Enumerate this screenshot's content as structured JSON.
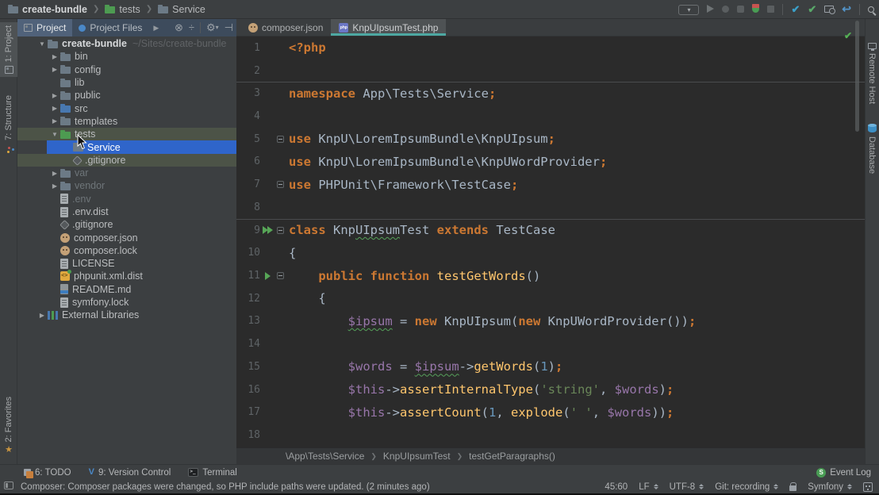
{
  "navbar": {
    "breadcrumbs": [
      {
        "label": "create-bundle",
        "icon": "folder"
      },
      {
        "label": "tests",
        "icon": "folder-green"
      },
      {
        "label": "Service",
        "icon": "folder"
      }
    ],
    "toolbar_icons": [
      "run-config-combo",
      "run",
      "debug",
      "kill",
      "run-with-coverage",
      "stop",
      "sep",
      "update-project",
      "commit",
      "local-history",
      "rollback",
      "sep",
      "search-everywhere"
    ]
  },
  "left_stripe": {
    "top": [
      {
        "label": "1: Project",
        "icon": "project"
      },
      {
        "label": "7: Structure",
        "icon": "structure"
      }
    ],
    "bottom": [
      {
        "label": "2: Favorites",
        "icon": "star"
      }
    ]
  },
  "right_stripe": {
    "items": [
      {
        "label": "Remote Host",
        "icon": "remote"
      },
      {
        "label": "Database",
        "icon": "db"
      }
    ]
  },
  "project_panel": {
    "tabs": [
      {
        "label": "Project",
        "selected": true
      },
      {
        "label": "Project Files",
        "selected": false
      }
    ],
    "header_icons": [
      "locate",
      "collapse-all",
      "sep",
      "settings",
      "hide"
    ],
    "tree": [
      {
        "depth": 0,
        "arrow": "down",
        "icon": "folder",
        "label": "create-bundle",
        "bold": true,
        "extra": "~/Sites/create-bundle"
      },
      {
        "depth": 1,
        "arrow": "right",
        "icon": "folder",
        "label": "bin"
      },
      {
        "depth": 1,
        "arrow": "right",
        "icon": "folder",
        "label": "config"
      },
      {
        "depth": 1,
        "arrow": "none",
        "icon": "folder",
        "label": "lib"
      },
      {
        "depth": 1,
        "arrow": "right",
        "icon": "folder",
        "label": "public"
      },
      {
        "depth": 1,
        "arrow": "right",
        "icon": "folder-src",
        "label": "src"
      },
      {
        "depth": 1,
        "arrow": "right",
        "icon": "folder",
        "label": "templates"
      },
      {
        "depth": 1,
        "arrow": "down",
        "icon": "folder-test",
        "label": "tests",
        "hl": "green"
      },
      {
        "depth": 2,
        "arrow": "none",
        "icon": "folder",
        "label": "Service",
        "hl": "selected"
      },
      {
        "depth": 2,
        "arrow": "none",
        "icon": "gitignore",
        "label": ".gitignore",
        "hl": "green"
      },
      {
        "depth": 1,
        "arrow": "right",
        "icon": "folder",
        "label": "var",
        "dim": true
      },
      {
        "depth": 1,
        "arrow": "right",
        "icon": "folder",
        "label": "vendor",
        "dim": true
      },
      {
        "depth": 1,
        "arrow": "none",
        "icon": "file",
        "label": ".env",
        "dim": true
      },
      {
        "depth": 1,
        "arrow": "none",
        "icon": "file",
        "label": ".env.dist"
      },
      {
        "depth": 1,
        "arrow": "none",
        "icon": "gitignore",
        "label": ".gitignore"
      },
      {
        "depth": 1,
        "arrow": "none",
        "icon": "composer",
        "label": "composer.json"
      },
      {
        "depth": 1,
        "arrow": "none",
        "icon": "composer",
        "label": "composer.lock"
      },
      {
        "depth": 1,
        "arrow": "none",
        "icon": "file",
        "label": "LICENSE"
      },
      {
        "depth": 1,
        "arrow": "none",
        "icon": "phpunit",
        "label": "phpunit.xml.dist"
      },
      {
        "depth": 1,
        "arrow": "none",
        "icon": "readme",
        "label": "README.md"
      },
      {
        "depth": 1,
        "arrow": "none",
        "icon": "file",
        "label": "symfony.lock"
      },
      {
        "depth": 0,
        "arrow": "right",
        "icon": "libs",
        "label": "External Libraries"
      }
    ]
  },
  "editor": {
    "tabs": [
      {
        "label": "composer.json",
        "icon": "composer",
        "active": false
      },
      {
        "label": "KnpUIpsumTest.php",
        "icon": "php-file",
        "active": true
      }
    ],
    "lines": [
      {
        "n": "1",
        "tokens": [
          [
            "tag",
            "<?php"
          ]
        ]
      },
      {
        "n": "2",
        "tokens": []
      },
      {
        "n": "3",
        "sep": true,
        "tokens": [
          [
            "kw",
            "namespace"
          ],
          [
            "d",
            " App\\Tests\\Service"
          ],
          [
            "kw",
            ";"
          ]
        ]
      },
      {
        "n": "4",
        "tokens": []
      },
      {
        "n": "5",
        "fold": true,
        "tokens": [
          [
            "kw",
            "use"
          ],
          [
            "d",
            " KnpU\\LoremIpsumBundle\\KnpUIpsum"
          ],
          [
            "kw",
            ";"
          ]
        ]
      },
      {
        "n": "6",
        "tokens": [
          [
            "kw",
            "use"
          ],
          [
            "d",
            " KnpU\\LoremIpsumBundle\\KnpUWordProvider"
          ],
          [
            "kw",
            ";"
          ]
        ]
      },
      {
        "n": "7",
        "fold": true,
        "tokens": [
          [
            "kw",
            "use"
          ],
          [
            "d",
            " PHPUnit\\Framework\\TestCase"
          ],
          [
            "kw",
            ";"
          ]
        ]
      },
      {
        "n": "8",
        "tokens": []
      },
      {
        "n": "9",
        "sep": true,
        "run": "class",
        "fold": true,
        "tokens": [
          [
            "kw",
            "class"
          ],
          [
            "d",
            " Knp"
          ],
          [
            "dw",
            "UIpsum"
          ],
          [
            "d",
            "Test "
          ],
          [
            "kw",
            "extends"
          ],
          [
            "d",
            " TestCase"
          ]
        ]
      },
      {
        "n": "10",
        "tokens": [
          [
            "d",
            "{"
          ]
        ]
      },
      {
        "n": "11",
        "run": "method",
        "fold": true,
        "tokens": [
          [
            "d",
            "    "
          ],
          [
            "kw",
            "public"
          ],
          [
            "d",
            " "
          ],
          [
            "kw",
            "function"
          ],
          [
            "d",
            " "
          ],
          [
            "fn",
            "testGetWords"
          ],
          [
            "d",
            "()"
          ]
        ]
      },
      {
        "n": "12",
        "tokens": [
          [
            "d",
            "    {"
          ]
        ]
      },
      {
        "n": "13",
        "tokens": [
          [
            "d",
            "        "
          ],
          [
            "vw",
            "$ipsum"
          ],
          [
            "d",
            " = "
          ],
          [
            "kw",
            "new"
          ],
          [
            "d",
            " KnpUIpsum("
          ],
          [
            "kw",
            "new"
          ],
          [
            "d",
            " KnpUWordProvider())"
          ],
          [
            "kw",
            ";"
          ]
        ]
      },
      {
        "n": "14",
        "tokens": []
      },
      {
        "n": "15",
        "tokens": [
          [
            "d",
            "        "
          ],
          [
            "v",
            "$words"
          ],
          [
            "d",
            " = "
          ],
          [
            "vw",
            "$ipsum"
          ],
          [
            "d",
            "->"
          ],
          [
            "fn",
            "getWords"
          ],
          [
            "d",
            "("
          ],
          [
            "num",
            "1"
          ],
          [
            "d",
            ")"
          ],
          [
            "kw",
            ";"
          ]
        ]
      },
      {
        "n": "16",
        "tokens": [
          [
            "d",
            "        "
          ],
          [
            "v",
            "$this"
          ],
          [
            "d",
            "->"
          ],
          [
            "fn",
            "assertInternalType"
          ],
          [
            "d",
            "("
          ],
          [
            "str",
            "'string'"
          ],
          [
            "d",
            ", "
          ],
          [
            "v",
            "$words"
          ],
          [
            "d",
            ")"
          ],
          [
            "kw",
            ";"
          ]
        ]
      },
      {
        "n": "17",
        "tokens": [
          [
            "d",
            "        "
          ],
          [
            "v",
            "$this"
          ],
          [
            "d",
            "->"
          ],
          [
            "fn",
            "assertCount"
          ],
          [
            "d",
            "("
          ],
          [
            "num",
            "1"
          ],
          [
            "d",
            ", "
          ],
          [
            "fn",
            "explode"
          ],
          [
            "d",
            "("
          ],
          [
            "str",
            "' '"
          ],
          [
            "d",
            ", "
          ],
          [
            "v",
            "$words"
          ],
          [
            "d",
            "))"
          ],
          [
            "kw",
            ";"
          ]
        ]
      },
      {
        "n": "18",
        "tokens": []
      }
    ],
    "breadcrumbs": [
      "\\App\\Tests\\Service",
      "KnpUIpsumTest",
      "testGetParagraphs()"
    ]
  },
  "bottom_bar": {
    "left": [
      {
        "label": "6: TODO",
        "icon": "todo"
      },
      {
        "label": "9: Version Control",
        "icon": "vcs"
      },
      {
        "label": "Terminal",
        "icon": "terminal"
      }
    ],
    "right": [
      {
        "label": "Event Log",
        "icon": "eventlog"
      }
    ]
  },
  "status_bar": {
    "message": "Composer: Composer packages were changed, so PHP include paths were updated. (2 minutes ago)",
    "widgets": [
      {
        "label": "45:60"
      },
      {
        "label": "LF",
        "updown": true
      },
      {
        "label": "UTF-8",
        "updown": true
      },
      {
        "label": "Git: recording",
        "updown": true
      },
      {
        "icon": "lock"
      },
      {
        "label": "Symfony",
        "updown": true
      },
      {
        "icon": "face"
      }
    ]
  },
  "colors": {
    "accent_selection": "#2F65CA",
    "test_root_highlight": "#4C5347",
    "active_tab_underline": "#4DA8A2",
    "keyword": "#CC7832",
    "string": "#6A8759",
    "number": "#6897BB",
    "variable": "#9876AA",
    "method": "#FFC66D"
  }
}
